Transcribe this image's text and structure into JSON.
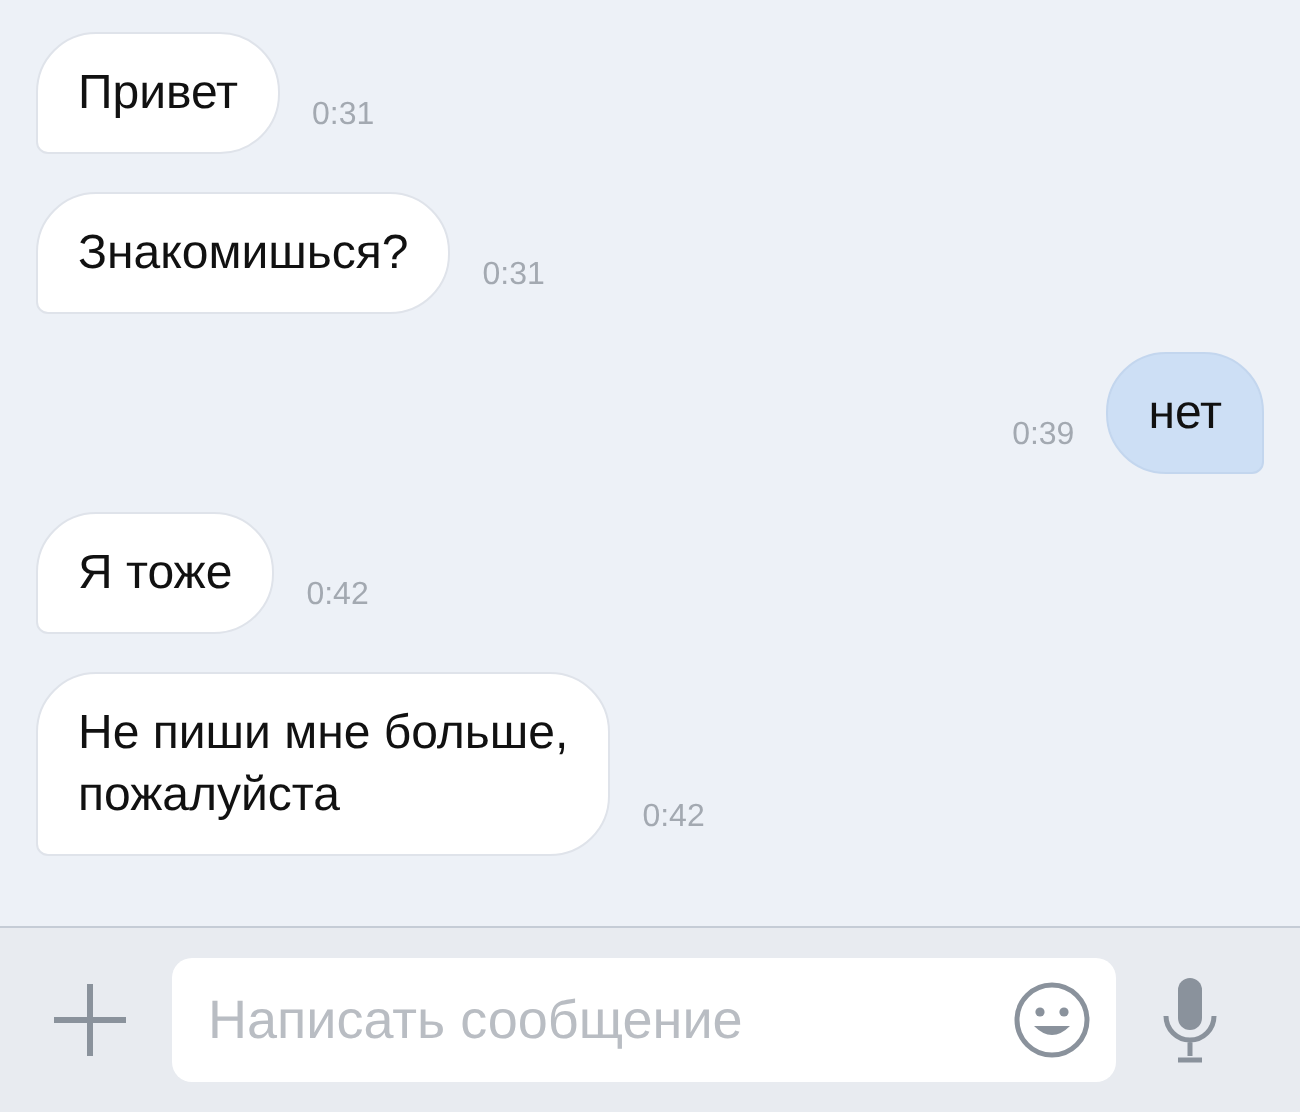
{
  "messages": [
    {
      "text": "Привет",
      "time": "0:31",
      "outgoing": false
    },
    {
      "text": "Знакомишься?",
      "time": "0:31",
      "outgoing": false
    },
    {
      "text": "нет",
      "time": "0:39",
      "outgoing": true
    },
    {
      "text": "Я тоже",
      "time": "0:42",
      "outgoing": false
    },
    {
      "text": "Не пиши мне больше,\nпожалуйста",
      "time": "0:42",
      "outgoing": false
    }
  ],
  "composer": {
    "placeholder": "Написать сообщение"
  }
}
